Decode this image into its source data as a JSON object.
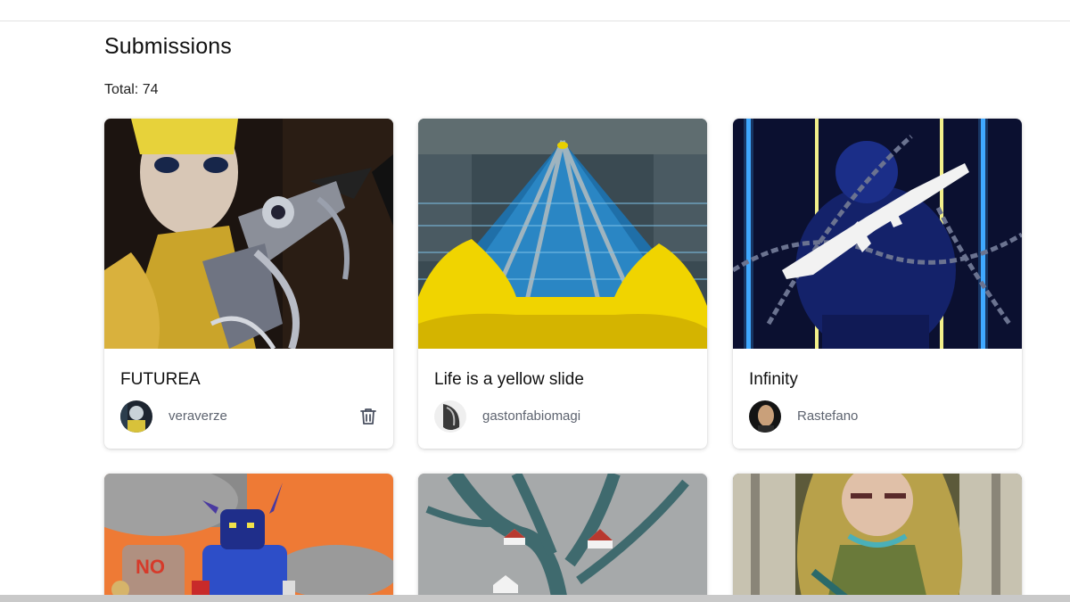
{
  "header": {
    "title": "Submissions",
    "total_label": "Total: 74"
  },
  "submissions": [
    {
      "title": "FUTUREA",
      "author": "veraverze",
      "can_delete": true,
      "avatar_icon": "user-avatar"
    },
    {
      "title": "Life is a yellow slide",
      "author": "gastonfabiomagi",
      "can_delete": false,
      "avatar_icon": "user-avatar"
    },
    {
      "title": "Infinity",
      "author": "Rastefano",
      "can_delete": false,
      "avatar_icon": "user-avatar"
    },
    {
      "title": "",
      "author": ""
    },
    {
      "title": "",
      "author": ""
    },
    {
      "title": "",
      "author": ""
    }
  ],
  "icons": {
    "delete": "trash-icon"
  },
  "colors": {
    "author_text": "#5e6470",
    "card_shadow": "#d0d0d0"
  }
}
